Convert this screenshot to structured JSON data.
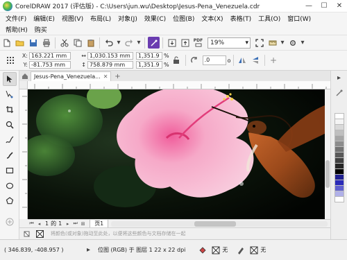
{
  "window": {
    "title": "CorelDRAW 2017 (评估版) - C:\\Users\\jun.wu\\Desktop\\Jesus-Pena_Venezuela.cdr",
    "minimize": "—",
    "maximize": "☐",
    "close": "✕"
  },
  "menu": {
    "row1": [
      "文件(F)",
      "编辑(E)",
      "视图(V)",
      "布局(L)",
      "对象(J)",
      "效果(C)",
      "位图(B)",
      "文本(X)",
      "表格(T)",
      "工具(O)",
      "窗口(W)"
    ],
    "row2": [
      "帮助(H)",
      "购买"
    ]
  },
  "toolbar": {
    "zoom_value": "19%",
    "zoom_arrow": "▾",
    "pdf_label": "PDF"
  },
  "properties": {
    "x_label": "X:",
    "x_value": "163.221 mm",
    "y_label": "Y:",
    "y_value": "-81.753 mm",
    "width_value": "1,030.153 mm",
    "height_value": "758.879 mm",
    "scale_x": "1,351.9",
    "scale_y": "1,351.9",
    "percent": "%",
    "angle_value": ".0",
    "angle_unit": "o"
  },
  "document": {
    "tab_label": "Jesus-Pena_Venezuela...",
    "tab_close": "✕",
    "add_tab": "+"
  },
  "pagebar": {
    "page_current": "1",
    "page_of": "的",
    "page_total": "1",
    "page_tab": "页1"
  },
  "colorbar": {
    "hint": "将颜色(或对象)拖动至此处，以便将这些颜色与文档存储在一起"
  },
  "status": {
    "coords": "( 346.839, -408.957 )",
    "object_info": "位图 (RGB) 于 图层 1 22 x 22 dpi",
    "fill_none": "无"
  },
  "palette": [
    "#ffffff",
    "#f4f4f4",
    "#d9d9d9",
    "#bfbfbf",
    "#a6a6a6",
    "#8c8c8c",
    "#737373",
    "#595959",
    "#404040",
    "#262626",
    "#000000",
    "#1f1f8f",
    "#2a2ab8",
    "#6060d0",
    "#b0b0e8",
    "#ffffff"
  ]
}
